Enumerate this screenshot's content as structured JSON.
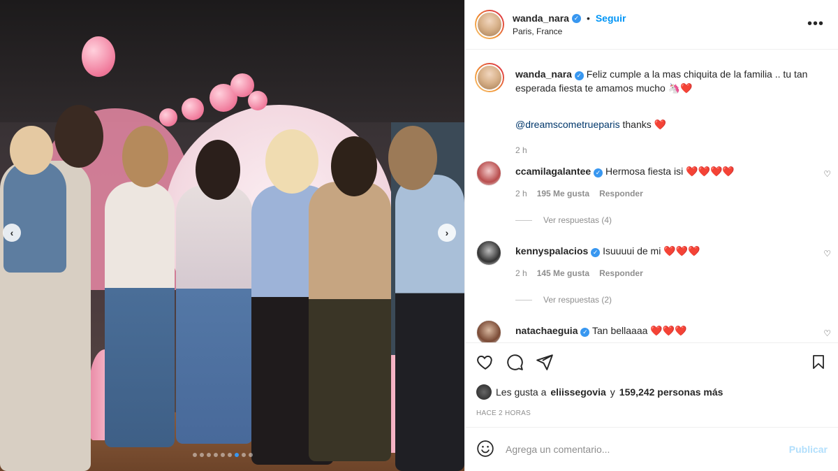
{
  "header": {
    "username": "wanda_nara",
    "separator": "•",
    "follow_label": "Seguir",
    "location": "Paris, France",
    "more_icon": "more-options-icon"
  },
  "caption": {
    "username": "wanda_nara",
    "text": "Feliz cumple a la mas chiquita de la familia .. tu tan esperada fiesta te amamos mucho 🦄",
    "heart": "❤️",
    "mention": "@dreamscometrueparis",
    "mention_suffix": "thanks",
    "time": "2 h"
  },
  "comments": [
    {
      "username": "ccamilagalantee",
      "text": "Hermosa fiesta isi",
      "hearts": "❤️❤️❤️❤️",
      "time": "2 h",
      "likes": "195 Me gusta",
      "reply_label": "Responder",
      "view_replies": "Ver respuestas (4)"
    },
    {
      "username": "kennyspalacios",
      "text": "Isuuuui de mi",
      "hearts": "❤️❤️❤️",
      "time": "2 h",
      "likes": "145 Me gusta",
      "reply_label": "Responder",
      "view_replies": "Ver respuestas (2)"
    },
    {
      "username": "natachaeguia",
      "text": "Tan bellaaaa",
      "hearts": "❤️❤️❤️"
    }
  ],
  "likes_summary": {
    "prefix": "Les gusta a",
    "liker": "eliissegovia",
    "conj": "y",
    "others": "159,242 personas más"
  },
  "posted": "HACE 2 HORAS",
  "comment_box": {
    "placeholder": "Agrega un comentario...",
    "publish_label": "Publicar"
  },
  "carousel": {
    "total_slides": 9,
    "active_index": 6
  },
  "colors": {
    "accent": "#0095f6",
    "verified": "#3897f0",
    "publish_disabled": "#b2dffc",
    "muted": "#8e8e8e"
  }
}
